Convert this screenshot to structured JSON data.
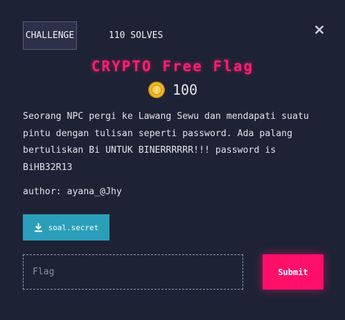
{
  "tabs": {
    "challenge_label": "CHALLENGE",
    "solves_label": "110 SOLVES"
  },
  "challenge": {
    "title": "CRYPTO Free Flag",
    "points": "100",
    "coin_icon": "coin-icon",
    "description": "Seorang NPC pergi ke Lawang Sewu dan mendapati suatu pintu dengan tulisan seperti password. Ada palang bertuliskan Bi UNTUK BINERRRRRR!!! password is BiHB32R13",
    "author": "author: ayana_@Jhy"
  },
  "file": {
    "label": "soal.secret",
    "icon": "download-icon"
  },
  "form": {
    "flag_placeholder": "Flag",
    "flag_value": "",
    "submit_label": "Submit"
  },
  "colors": {
    "background": "#1e2235",
    "accent_pink": "#ff0f6a",
    "file_button": "#2b9fba"
  }
}
